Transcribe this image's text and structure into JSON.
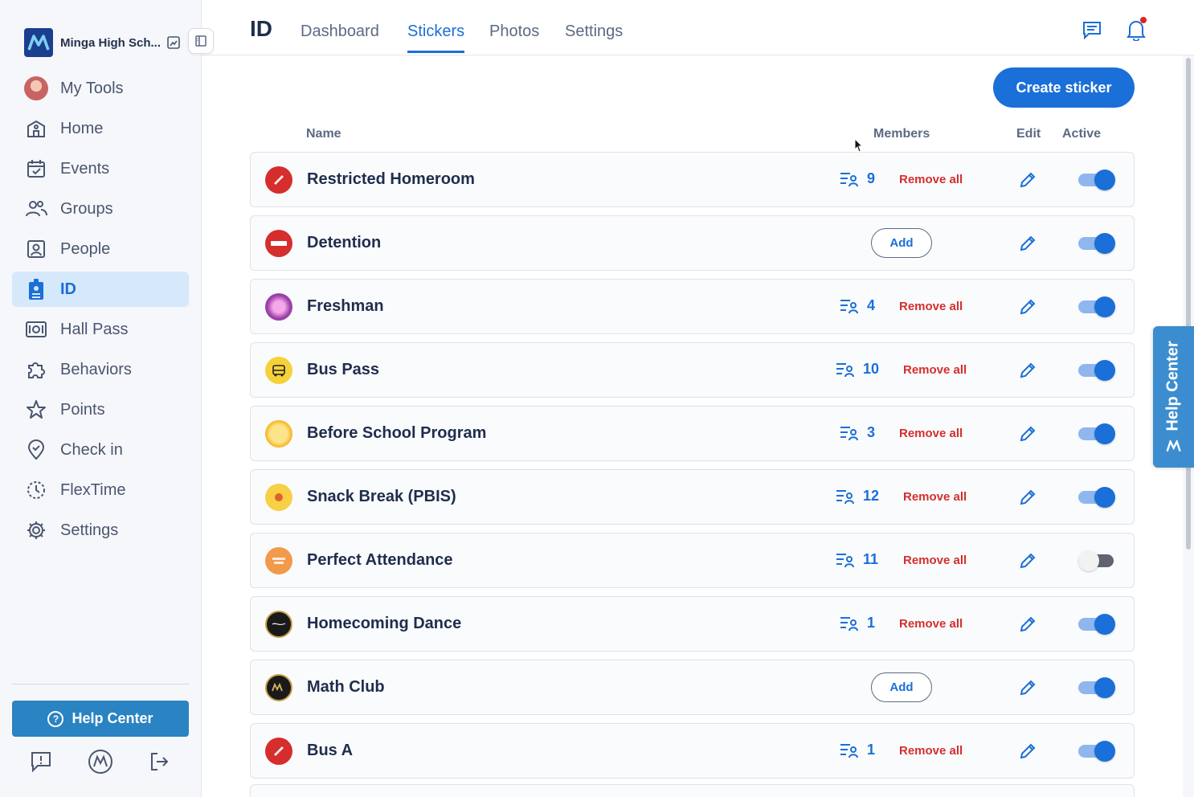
{
  "school": {
    "name": "Minga High Sch..."
  },
  "sidebar": {
    "items": [
      {
        "label": "My Tools",
        "icon": "avatar"
      },
      {
        "label": "Home",
        "icon": "school-building-icon"
      },
      {
        "label": "Events",
        "icon": "calendar-check-icon"
      },
      {
        "label": "Groups",
        "icon": "users-icon"
      },
      {
        "label": "People",
        "icon": "person-card-icon"
      },
      {
        "label": "ID",
        "icon": "id-badge-icon",
        "active": true
      },
      {
        "label": "Hall Pass",
        "icon": "hall-pass-icon"
      },
      {
        "label": "Behaviors",
        "icon": "puzzle-icon"
      },
      {
        "label": "Points",
        "icon": "star-icon"
      },
      {
        "label": "Check in",
        "icon": "location-pin-icon"
      },
      {
        "label": "FlexTime",
        "icon": "flextime-icon"
      },
      {
        "label": "Settings",
        "icon": "gear-icon"
      }
    ],
    "help_label": "Help Center"
  },
  "header": {
    "title": "ID",
    "tabs": [
      "Dashboard",
      "Stickers",
      "Photos",
      "Settings"
    ],
    "active_tab": "Stickers"
  },
  "main": {
    "create_label": "Create sticker",
    "columns": {
      "name": "Name",
      "members": "Members",
      "edit": "Edit",
      "active": "Active"
    },
    "remove_label": "Remove all",
    "add_label": "Add",
    "rows": [
      {
        "name": "Restricted Homeroom",
        "members": "9",
        "active": true,
        "icon_color": "#d62d2d"
      },
      {
        "name": "Detention",
        "members": null,
        "active": true,
        "icon_color": "#d62d2d"
      },
      {
        "name": "Freshman",
        "members": "4",
        "active": true,
        "icon_color": "#9b3fa8"
      },
      {
        "name": "Bus Pass",
        "members": "10",
        "active": true,
        "icon_color": "#f6d23a"
      },
      {
        "name": "Before School Program",
        "members": "3",
        "active": true,
        "icon_color": "#f5b41e"
      },
      {
        "name": "Snack Break (PBIS)",
        "members": "12",
        "active": true,
        "icon_color": "#f7d046"
      },
      {
        "name": "Perfect Attendance",
        "members": "11",
        "active": false,
        "icon_color": "#f29a4a"
      },
      {
        "name": "Homecoming Dance",
        "members": "1",
        "active": true,
        "icon_color": "#1a1a1a"
      },
      {
        "name": "Math Club",
        "members": null,
        "active": true,
        "icon_color": "#1a1a1a"
      },
      {
        "name": "Bus A",
        "members": "1",
        "active": true,
        "icon_color": "#d62d2d"
      }
    ]
  },
  "colors": {
    "accent": "#1a6fd8",
    "danger": "#d32f2f",
    "help": "#2a83c2"
  }
}
